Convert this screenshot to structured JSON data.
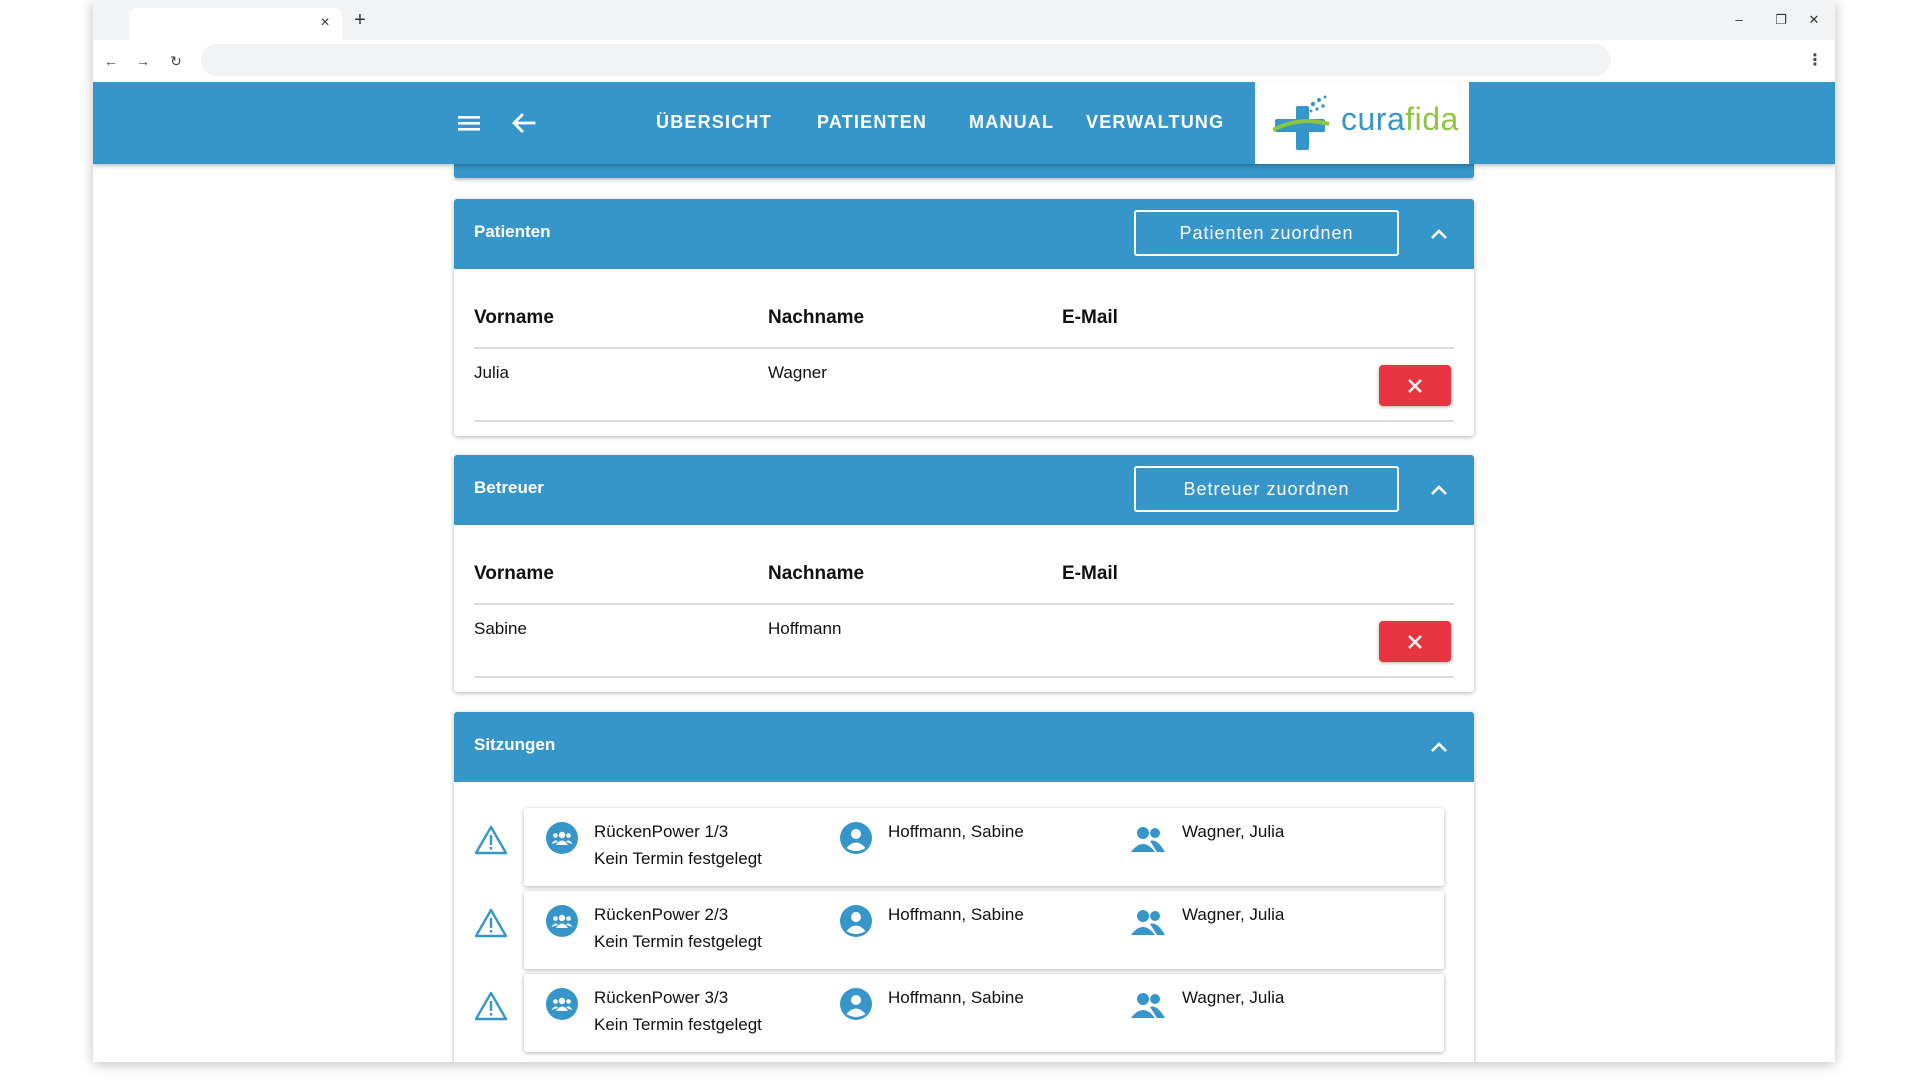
{
  "browser": {
    "tab_title": "",
    "tab_close": "×",
    "new_tab": "+",
    "minimize": "–",
    "restore": "❐",
    "close": "✕",
    "back": "←",
    "forward": "→",
    "reload": "↻",
    "address": "",
    "menu": "⋮"
  },
  "header": {
    "nav": [
      "ÜBERSICHT",
      "PATIENTEN",
      "MANUAL",
      "VERWALTUNG"
    ],
    "logo": {
      "part1": "cura",
      "part2": "fida"
    }
  },
  "colors": {
    "primary": "#3796c9",
    "danger": "#e63440",
    "logo_green": "#8cc63f"
  },
  "patients_panel": {
    "title": "Patienten",
    "assign_button": "Patienten zuordnen",
    "columns": [
      "Vorname",
      "Nachname",
      "E-Mail"
    ],
    "rows": [
      {
        "first_name": "Julia",
        "last_name": "Wagner",
        "email": ""
      }
    ]
  },
  "caregivers_panel": {
    "title": "Betreuer",
    "assign_button": "Betreuer zuordnen",
    "columns": [
      "Vorname",
      "Nachname",
      "E-Mail"
    ],
    "rows": [
      {
        "first_name": "Sabine",
        "last_name": "Hoffmann",
        "email": ""
      }
    ]
  },
  "sessions_panel": {
    "title": "Sitzungen",
    "items": [
      {
        "title": "RückenPower 1/3",
        "status": "Kein Termin festgelegt",
        "therapist": "Hoffmann, Sabine",
        "patient": "Wagner, Julia",
        "warning_icon": "warning-icon",
        "group_icon": "group-icon"
      },
      {
        "title": "RückenPower 2/3",
        "status": "Kein Termin festgelegt",
        "therapist": "Hoffmann, Sabine",
        "patient": "Wagner, Julia",
        "warning_icon": "warning-icon",
        "group_icon": "group-icon"
      },
      {
        "title": "RückenPower 3/3",
        "status": "Kein Termin festgelegt",
        "therapist": "Hoffmann, Sabine",
        "patient": "Wagner, Julia",
        "warning_icon": "warning-icon",
        "group_icon": "group-icon"
      }
    ]
  }
}
